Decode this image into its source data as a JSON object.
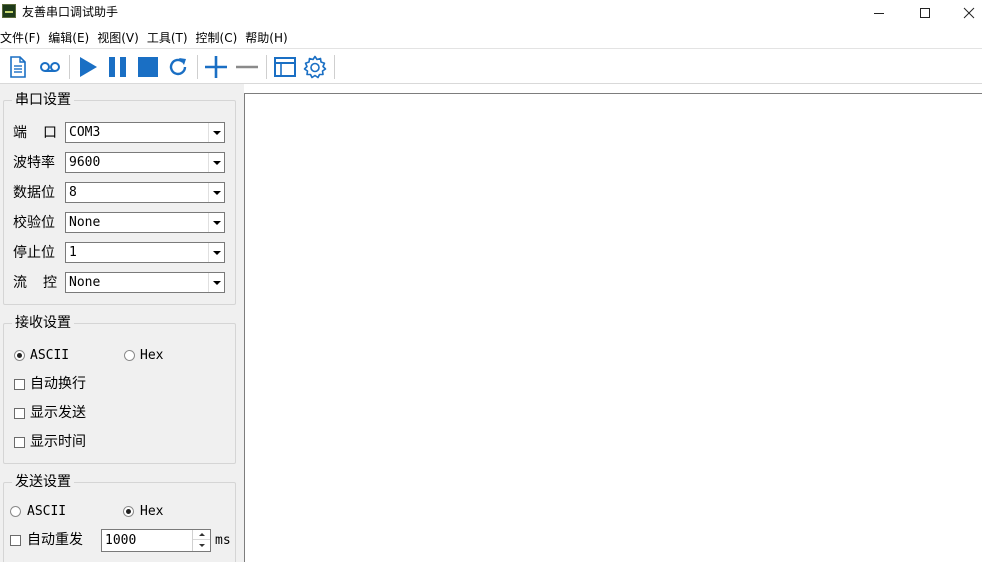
{
  "window": {
    "title": "友善串口调试助手",
    "icons": [
      "app-icon",
      "minimize-icon",
      "maximize-icon",
      "close-icon"
    ]
  },
  "menu": [
    {
      "label": "文件(F)"
    },
    {
      "label": "编辑(E)"
    },
    {
      "label": "视图(V)"
    },
    {
      "label": "工具(T)"
    },
    {
      "label": "控制(C)"
    },
    {
      "label": "帮助(H)"
    }
  ],
  "toolbar": {
    "icons": [
      "new-document-icon",
      "record-icon",
      "start-icon",
      "pause-icon",
      "stop-icon",
      "refresh-icon",
      "add-icon",
      "remove-icon",
      "window-icon",
      "settings-icon"
    ],
    "accent_color": "#1a6fc4"
  },
  "serial_settings": {
    "title": "串口设置",
    "fields": [
      {
        "label": "端口",
        "value": "COM3"
      },
      {
        "label": "波特率",
        "value": "9600"
      },
      {
        "label": "数据位",
        "value": "8"
      },
      {
        "label": "校验位",
        "value": "None"
      },
      {
        "label": "停止位",
        "value": "1"
      },
      {
        "label": "流控",
        "value": "None"
      }
    ]
  },
  "receive_settings": {
    "title": "接收设置",
    "mode_ascii": "ASCII",
    "mode_hex": "Hex",
    "selected_mode": "ASCII",
    "auto_wrap": "自动换行",
    "show_send": "显示发送",
    "show_time": "显示时间"
  },
  "send_settings": {
    "title": "发送设置",
    "mode_ascii": "ASCII",
    "mode_hex": "Hex",
    "selected_mode": "Hex",
    "auto_resend": "自动重发",
    "interval": "1000",
    "interval_unit": "ms"
  }
}
